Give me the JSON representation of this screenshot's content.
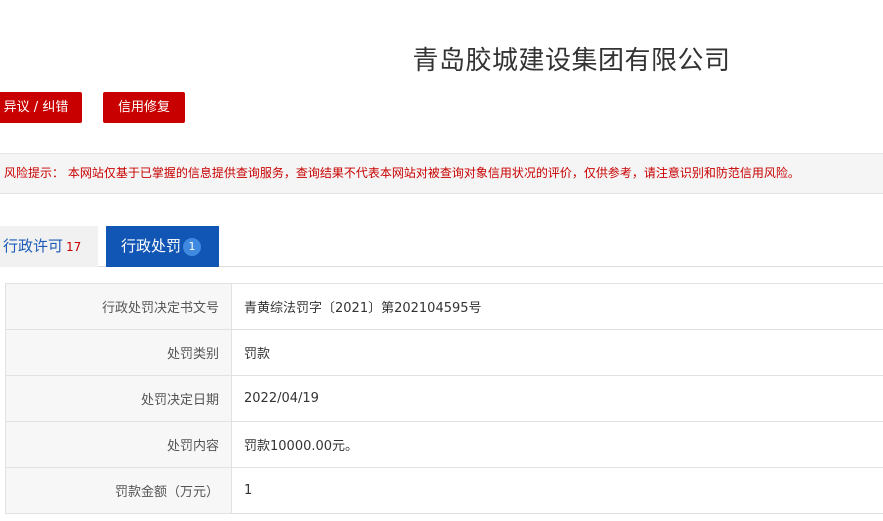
{
  "company": {
    "name": "青岛胶城建设集团有限公司"
  },
  "actions": {
    "objection_label": "异议 / 纠错",
    "repair_label": "信用修复"
  },
  "risk_notice": "风险提示： 本网站仅基于已掌握的信息提供查询服务，查询结果不代表本网站对被查询对象信用状况的评价，仅供参考，请注意识别和防范信用风险。",
  "tabs": [
    {
      "label": "行政许可",
      "count": "17",
      "active": false
    },
    {
      "label": "行政处罚",
      "count": "1",
      "active": true
    }
  ],
  "details": [
    {
      "label": "行政处罚决定书文号",
      "value": "青黄综法罚字〔2021〕第202104595号"
    },
    {
      "label": "处罚类别",
      "value": "罚款"
    },
    {
      "label": "处罚决定日期",
      "value": "2022/04/19"
    },
    {
      "label": "处罚内容",
      "value": "罚款10000.00元。"
    },
    {
      "label": "罚款金额（万元）",
      "value": "1"
    }
  ]
}
